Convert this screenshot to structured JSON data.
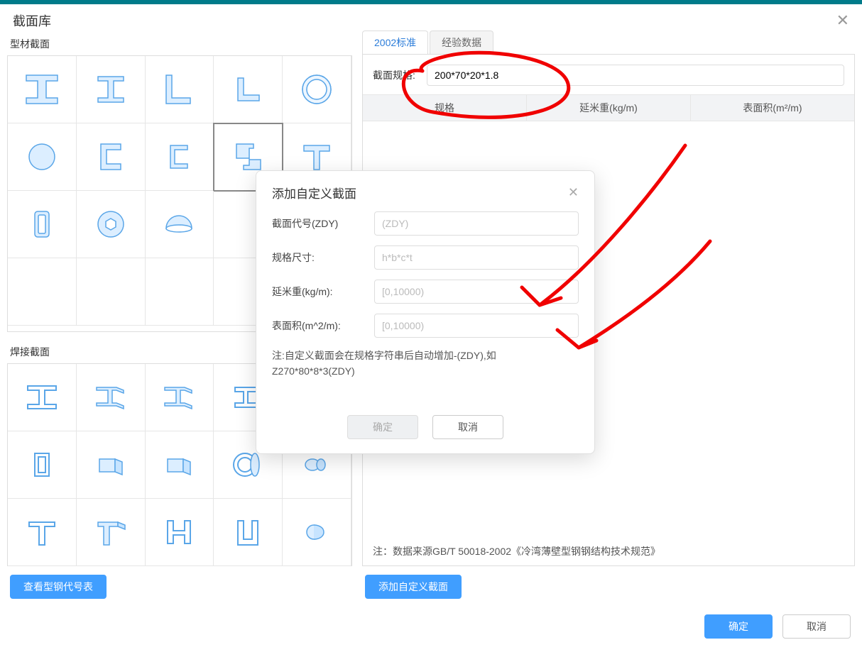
{
  "window": {
    "title": "截面库"
  },
  "left": {
    "section1_label": "型材截面",
    "section2_label": "焊接截面",
    "view_table_btn": "查看型钢代号表"
  },
  "right": {
    "tabs": [
      {
        "label": "2002标准",
        "active": true
      },
      {
        "label": "经验数据",
        "active": false
      }
    ],
    "spec_label": "截面规格:",
    "spec_value": "200*70*20*1.8",
    "table_headers": [
      "规格",
      "延米重(kg/m)",
      "表面积(m²/m)"
    ],
    "footnote": "注：数据来源GB/T 50018-2002《冷湾薄壁型钢钢结构技术规范》",
    "add_custom_btn": "添加自定义截面"
  },
  "modal": {
    "title": "添加自定义截面",
    "rows": [
      {
        "label": "截面代号(ZDY)",
        "placeholder": "(ZDY)"
      },
      {
        "label": "规格尺寸:",
        "placeholder": "h*b*c*t"
      },
      {
        "label": "延米重(kg/m):",
        "placeholder": "[0,10000)"
      },
      {
        "label": "表面积(m^2/m):",
        "placeholder": "[0,10000)"
      }
    ],
    "note": "注:自定义截面会在规格字符串后自动增加-(ZDY),如Z270*80*8*3(ZDY)",
    "ok": "确定",
    "cancel": "取消"
  },
  "bottom": {
    "ok": "确定",
    "cancel": "取消"
  }
}
